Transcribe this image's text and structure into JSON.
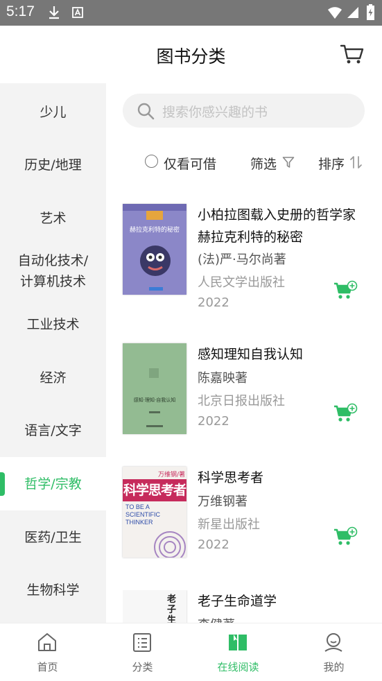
{
  "status": {
    "time": "5:17"
  },
  "header": {
    "title": "图书分类"
  },
  "sidebar": {
    "items": [
      {
        "label": "少儿"
      },
      {
        "label": "历史/地理"
      },
      {
        "label": "艺术"
      },
      {
        "label": "自动化技术/\n计算机技术"
      },
      {
        "label": "工业技术"
      },
      {
        "label": "经济"
      },
      {
        "label": "语言/文字"
      },
      {
        "label": "哲学/宗教",
        "active": true
      },
      {
        "label": "医药/卫生"
      },
      {
        "label": "生物科学"
      }
    ]
  },
  "search": {
    "placeholder": "搜索你感兴趣的书"
  },
  "filters": {
    "available_only": "仅看可借",
    "filter": "筛选",
    "sort": "排序"
  },
  "books": [
    {
      "title": "小柏拉图载入史册的哲学家赫拉克利特的秘密",
      "author": "(法)严·马尔尚著",
      "publisher": "人民文学出版社",
      "year": "2022",
      "cover_text": "赫拉克利特的秘密"
    },
    {
      "title": "感知理知自我认知",
      "author": "陈嘉映著",
      "publisher": "北京日报出版社",
      "year": "2022",
      "cover_text": "感知·理知·自我认知"
    },
    {
      "title": "科学思考者",
      "author": "万维钢著",
      "publisher": "新星出版社",
      "year": "2022",
      "cover_text": "科学思考者",
      "cover_subtext": "TO BE A SCIENTIFIC THINKER",
      "cover_author": "万维钢/著"
    },
    {
      "title": "老子生命道学",
      "author": "李健著",
      "publisher": "",
      "year": "",
      "cover_text": "老子生"
    }
  ],
  "tabbar": {
    "items": [
      {
        "label": "首页",
        "icon": "home-icon"
      },
      {
        "label": "分类",
        "icon": "category-icon"
      },
      {
        "label": "在线阅读",
        "icon": "book-open-icon",
        "active": true
      },
      {
        "label": "我的",
        "icon": "profile-icon"
      }
    ]
  },
  "colors": {
    "accent": "#2fbd66",
    "statusbar": "#777777",
    "sidebar_bg": "#f3f3f3"
  }
}
